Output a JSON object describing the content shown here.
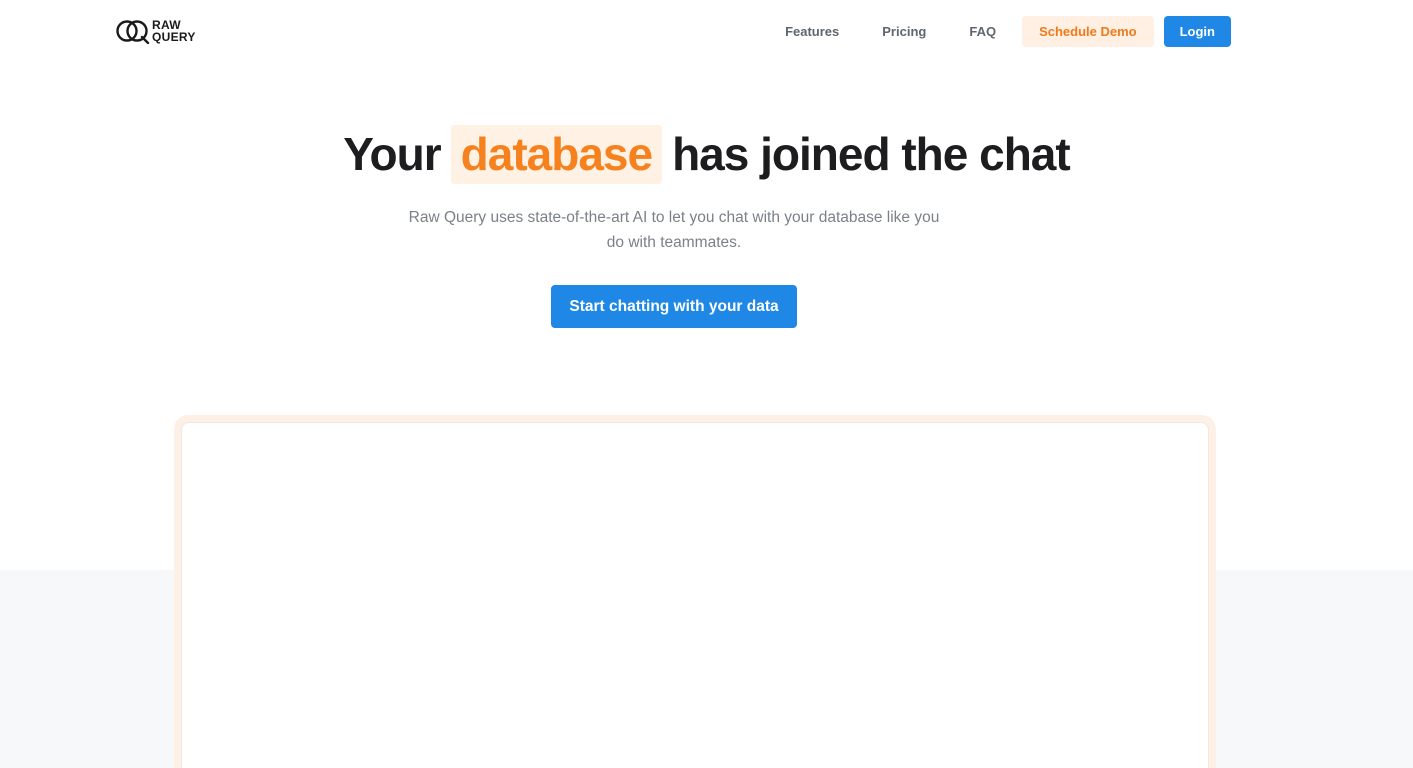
{
  "brand": {
    "line1": "RAW",
    "line2": "QUERY"
  },
  "nav": {
    "features": "Features",
    "pricing": "Pricing",
    "faq": "FAQ",
    "schedule_demo": "Schedule Demo",
    "login": "Login"
  },
  "hero": {
    "title_before": "Your",
    "title_highlight": "database",
    "title_after": "has joined the chat",
    "subtitle": "Raw Query uses state-of-the-art AI to let you chat with your database like you do with teammates.",
    "cta": "Start chatting with your data"
  },
  "colors": {
    "accent_orange": "#f5821f",
    "highlight_bg": "#fff1e3",
    "primary_blue": "#1f87e5"
  }
}
